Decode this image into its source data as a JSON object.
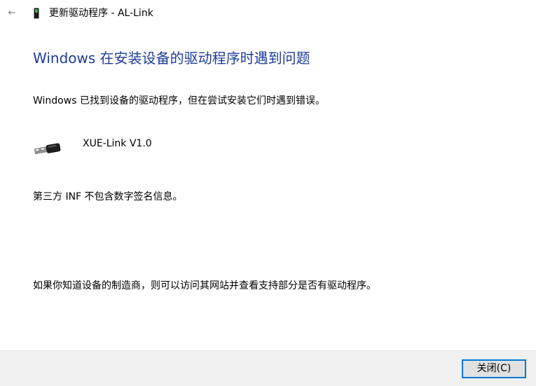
{
  "window": {
    "title": "更新驱动程序 - AL-Link",
    "back_glyph": "←"
  },
  "content": {
    "heading": "Windows 在安装设备的驱动程序时遇到问题",
    "found_message": "Windows 已找到设备的驱动程序，但在尝试安装它们时遇到错误。",
    "device": {
      "name": "XUE-Link V1.0",
      "icon": "usb-connector-icon"
    },
    "error_detail": "第三方 INF 不包含数字签名信息。",
    "advice": "如果你知道设备的制造商，则可以访问其网站并查看支持部分是否有驱动程序。"
  },
  "footer": {
    "close_label": "关闭(C)"
  },
  "colors": {
    "heading": "#1e3c9a",
    "footer_bg": "#f0f0f0",
    "button_border": "#0078d7"
  }
}
